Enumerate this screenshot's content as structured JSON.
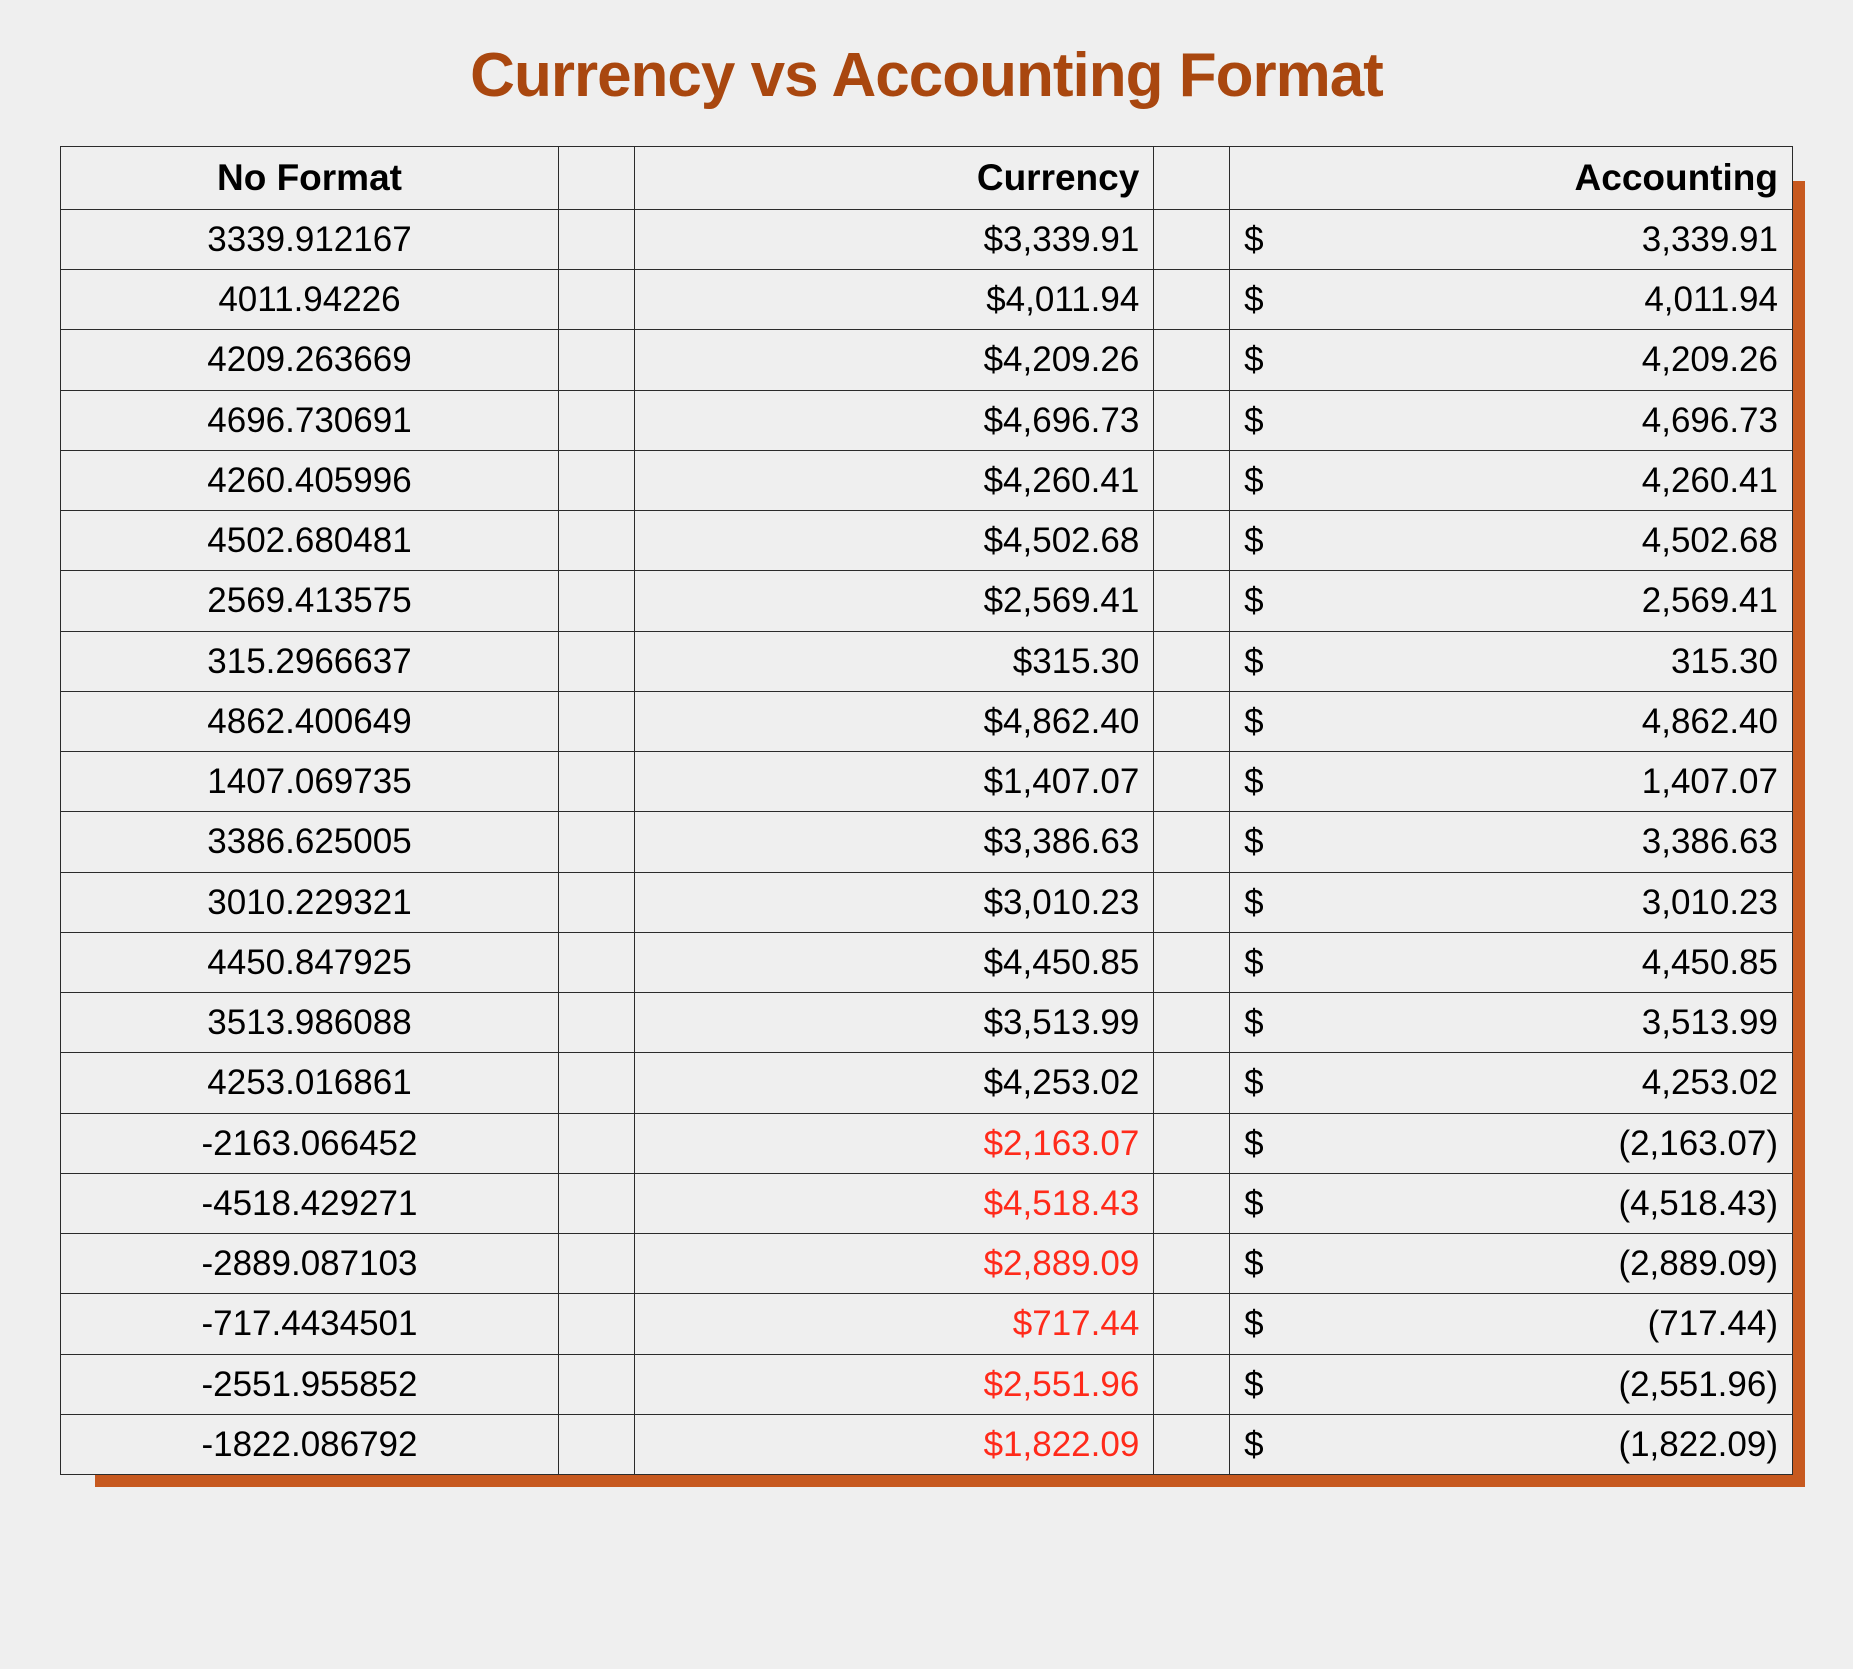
{
  "title": "Currency vs Accounting Format",
  "headers": {
    "noformat": "No Format",
    "currency": "Currency",
    "accounting": "Accounting"
  },
  "currency_symbol": "$",
  "rows": [
    {
      "noformat": "3339.912167",
      "currency": "$3,339.91",
      "currency_negative": false,
      "accounting": "3,339.91"
    },
    {
      "noformat": "4011.94226",
      "currency": "$4,011.94",
      "currency_negative": false,
      "accounting": "4,011.94"
    },
    {
      "noformat": "4209.263669",
      "currency": "$4,209.26",
      "currency_negative": false,
      "accounting": "4,209.26"
    },
    {
      "noformat": "4696.730691",
      "currency": "$4,696.73",
      "currency_negative": false,
      "accounting": "4,696.73"
    },
    {
      "noformat": "4260.405996",
      "currency": "$4,260.41",
      "currency_negative": false,
      "accounting": "4,260.41"
    },
    {
      "noformat": "4502.680481",
      "currency": "$4,502.68",
      "currency_negative": false,
      "accounting": "4,502.68"
    },
    {
      "noformat": "2569.413575",
      "currency": "$2,569.41",
      "currency_negative": false,
      "accounting": "2,569.41"
    },
    {
      "noformat": "315.2966637",
      "currency": "$315.30",
      "currency_negative": false,
      "accounting": "315.30"
    },
    {
      "noformat": "4862.400649",
      "currency": "$4,862.40",
      "currency_negative": false,
      "accounting": "4,862.40"
    },
    {
      "noformat": "1407.069735",
      "currency": "$1,407.07",
      "currency_negative": false,
      "accounting": "1,407.07"
    },
    {
      "noformat": "3386.625005",
      "currency": "$3,386.63",
      "currency_negative": false,
      "accounting": "3,386.63"
    },
    {
      "noformat": "3010.229321",
      "currency": "$3,010.23",
      "currency_negative": false,
      "accounting": "3,010.23"
    },
    {
      "noformat": "4450.847925",
      "currency": "$4,450.85",
      "currency_negative": false,
      "accounting": "4,450.85"
    },
    {
      "noformat": "3513.986088",
      "currency": "$3,513.99",
      "currency_negative": false,
      "accounting": "3,513.99"
    },
    {
      "noformat": "4253.016861",
      "currency": "$4,253.02",
      "currency_negative": false,
      "accounting": "4,253.02"
    },
    {
      "noformat": "-2163.066452",
      "currency": "$2,163.07",
      "currency_negative": true,
      "accounting": "(2,163.07)"
    },
    {
      "noformat": "-4518.429271",
      "currency": "$4,518.43",
      "currency_negative": true,
      "accounting": "(4,518.43)"
    },
    {
      "noformat": "-2889.087103",
      "currency": "$2,889.09",
      "currency_negative": true,
      "accounting": "(2,889.09)"
    },
    {
      "noformat": "-717.4434501",
      "currency": "$717.44",
      "currency_negative": true,
      "accounting": "(717.44)"
    },
    {
      "noformat": "-2551.955852",
      "currency": "$2,551.96",
      "currency_negative": true,
      "accounting": "(2,551.96)"
    },
    {
      "noformat": "-1822.086792",
      "currency": "$1,822.09",
      "currency_negative": true,
      "accounting": "(1,822.09)"
    }
  ]
}
